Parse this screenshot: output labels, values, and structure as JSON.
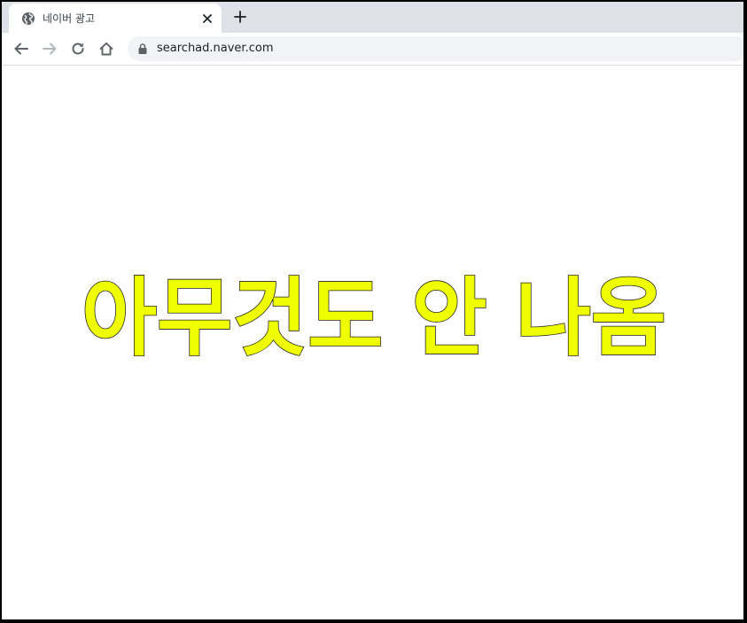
{
  "browser": {
    "tab": {
      "title": "네이버 광고",
      "favicon_icon": "globe-icon",
      "close_icon": "close-icon"
    },
    "new_tab_icon": "plus-icon",
    "toolbar": {
      "back_icon": "back-arrow-icon",
      "forward_icon": "forward-arrow-icon",
      "reload_icon": "reload-icon",
      "home_icon": "home-icon",
      "lock_icon": "lock-icon",
      "url": "searchad.naver.com"
    }
  },
  "page": {
    "headline": "아무것도 안 나옴",
    "headline_fill": "#f0ff00",
    "headline_stroke": "#222222"
  }
}
